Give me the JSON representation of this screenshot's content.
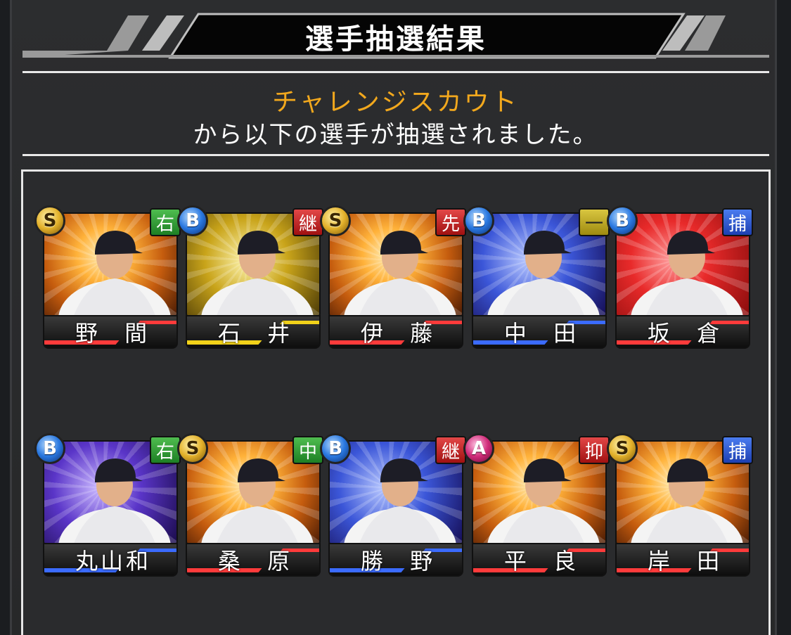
{
  "header": {
    "title": "選手抽選結果"
  },
  "message": {
    "line1": "チャレンジスカウト",
    "line2": "から以下の選手が抽選されました。"
  },
  "colors": {
    "accent_gold": "#f2a81d",
    "rank_S": "#e3b12b",
    "rank_A": "#d12c7a",
    "rank_B": "#2a78e0"
  },
  "players": [
    {
      "name": "野 間",
      "rank": "S",
      "position": "右",
      "pos_color": "green",
      "bg": "gold",
      "icon": "player-portrait-icon"
    },
    {
      "name": "石 井",
      "rank": "B",
      "position": "継",
      "pos_color": "red",
      "bg": "yellow",
      "icon": "player-portrait-icon"
    },
    {
      "name": "伊 藤",
      "rank": "S",
      "position": "先",
      "pos_color": "red",
      "bg": "gold",
      "icon": "player-portrait-icon"
    },
    {
      "name": "中 田",
      "rank": "B",
      "position": "一",
      "pos_color": "olive",
      "bg": "blue",
      "icon": "player-portrait-icon"
    },
    {
      "name": "坂 倉",
      "rank": "B",
      "position": "捕",
      "pos_color": "blue",
      "bg": "red",
      "icon": "player-portrait-icon"
    },
    {
      "name": "丸山和",
      "rank": "B",
      "position": "右",
      "pos_color": "green",
      "bg": "purple",
      "icon": "player-portrait-icon"
    },
    {
      "name": "桑 原",
      "rank": "S",
      "position": "中",
      "pos_color": "green",
      "bg": "gold",
      "icon": "player-portrait-icon"
    },
    {
      "name": "勝 野",
      "rank": "B",
      "position": "継",
      "pos_color": "red",
      "bg": "blue",
      "icon": "player-portrait-icon"
    },
    {
      "name": "平 良",
      "rank": "A",
      "position": "抑",
      "pos_color": "red",
      "bg": "gold",
      "icon": "player-portrait-icon"
    },
    {
      "name": "岸 田",
      "rank": "S",
      "position": "捕",
      "pos_color": "blue",
      "bg": "gold",
      "icon": "player-portrait-icon"
    }
  ]
}
